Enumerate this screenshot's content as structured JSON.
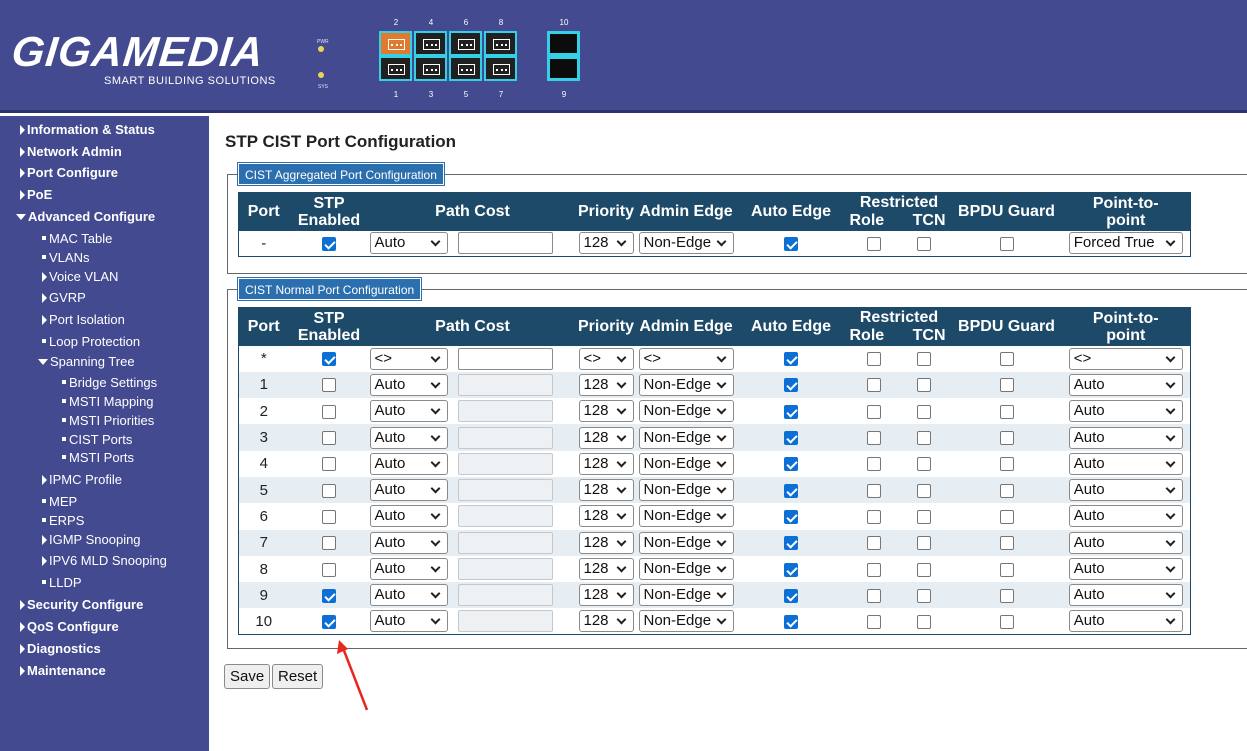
{
  "brand": {
    "logo": "GIGAMEDIA",
    "tagline": "SMART BUILDING SOLUTIONS",
    "led_labels": [
      "PWR",
      "SYS"
    ],
    "port_numbers_top": [
      "2",
      "4",
      "6",
      "8",
      "10"
    ],
    "port_numbers_bottom": [
      "1",
      "3",
      "5",
      "7",
      "9"
    ]
  },
  "sidebar": {
    "information_status": "Information & Status",
    "network_admin": "Network Admin",
    "port_configure": "Port Configure",
    "poe": "PoE",
    "advanced_configure": "Advanced Configure",
    "mac_table": "MAC Table",
    "vlans": "VLANs",
    "voice_vlan": "Voice VLAN",
    "gvrp": "GVRP",
    "port_isolation": "Port Isolation",
    "loop_protection": "Loop Protection",
    "spanning_tree": "Spanning Tree",
    "bridge_settings": "Bridge Settings",
    "msti_mapping": "MSTI Mapping",
    "msti_priorities": "MSTI Priorities",
    "cist_ports": "CIST Ports",
    "msti_ports": "MSTI Ports",
    "ipmc_profile": "IPMC Profile",
    "mep": "MEP",
    "erps": "ERPS",
    "igmp_snooping": "IGMP Snooping",
    "ipv6_mld_snooping": "IPV6 MLD Snooping",
    "lldp": "LLDP",
    "security_configure": "Security Configure",
    "qos_configure": "QoS Configure",
    "diagnostics": "Diagnostics",
    "maintenance": "Maintenance"
  },
  "page": {
    "title": "STP CIST Port Configuration"
  },
  "columns": {
    "port": "Port",
    "stp": "STP",
    "enabled": "Enabled",
    "path_cost": "Path Cost",
    "priority": "Priority",
    "admin_edge": "Admin Edge",
    "auto_edge": "Auto Edge",
    "restricted": "Restricted",
    "role": "Role",
    "tcn": "TCN",
    "bpdu_guard": "BPDU Guard",
    "p2p_top": "Point-to-",
    "p2p_bottom": "point"
  },
  "aggregated": {
    "legend": "CIST Aggregated Port Configuration",
    "rows": [
      {
        "port": "-",
        "stp": true,
        "path_cost": "Auto",
        "path_value": "",
        "path_enabled": true,
        "priority": "128",
        "admin_edge": "Non-Edge",
        "auto_edge": true,
        "restricted_role": false,
        "restricted_tcn": false,
        "bpdu_guard": false,
        "p2p": "Forced True"
      }
    ]
  },
  "normal": {
    "legend": "CIST Normal Port Configuration",
    "rows": [
      {
        "port": "*",
        "stp": true,
        "path_cost": "<>",
        "path_value": "",
        "path_enabled": true,
        "priority": "<>",
        "admin_edge": "<>",
        "auto_edge": true,
        "restricted_role": false,
        "restricted_tcn": false,
        "bpdu_guard": false,
        "p2p": "<>"
      },
      {
        "port": "1",
        "stp": false,
        "path_cost": "Auto",
        "path_value": "",
        "path_enabled": false,
        "priority": "128",
        "admin_edge": "Non-Edge",
        "auto_edge": true,
        "restricted_role": false,
        "restricted_tcn": false,
        "bpdu_guard": false,
        "p2p": "Auto"
      },
      {
        "port": "2",
        "stp": false,
        "path_cost": "Auto",
        "path_value": "",
        "path_enabled": false,
        "priority": "128",
        "admin_edge": "Non-Edge",
        "auto_edge": true,
        "restricted_role": false,
        "restricted_tcn": false,
        "bpdu_guard": false,
        "p2p": "Auto"
      },
      {
        "port": "3",
        "stp": false,
        "path_cost": "Auto",
        "path_value": "",
        "path_enabled": false,
        "priority": "128",
        "admin_edge": "Non-Edge",
        "auto_edge": true,
        "restricted_role": false,
        "restricted_tcn": false,
        "bpdu_guard": false,
        "p2p": "Auto"
      },
      {
        "port": "4",
        "stp": false,
        "path_cost": "Auto",
        "path_value": "",
        "path_enabled": false,
        "priority": "128",
        "admin_edge": "Non-Edge",
        "auto_edge": true,
        "restricted_role": false,
        "restricted_tcn": false,
        "bpdu_guard": false,
        "p2p": "Auto"
      },
      {
        "port": "5",
        "stp": false,
        "path_cost": "Auto",
        "path_value": "",
        "path_enabled": false,
        "priority": "128",
        "admin_edge": "Non-Edge",
        "auto_edge": true,
        "restricted_role": false,
        "restricted_tcn": false,
        "bpdu_guard": false,
        "p2p": "Auto"
      },
      {
        "port": "6",
        "stp": false,
        "path_cost": "Auto",
        "path_value": "",
        "path_enabled": false,
        "priority": "128",
        "admin_edge": "Non-Edge",
        "auto_edge": true,
        "restricted_role": false,
        "restricted_tcn": false,
        "bpdu_guard": false,
        "p2p": "Auto"
      },
      {
        "port": "7",
        "stp": false,
        "path_cost": "Auto",
        "path_value": "",
        "path_enabled": false,
        "priority": "128",
        "admin_edge": "Non-Edge",
        "auto_edge": true,
        "restricted_role": false,
        "restricted_tcn": false,
        "bpdu_guard": false,
        "p2p": "Auto"
      },
      {
        "port": "8",
        "stp": false,
        "path_cost": "Auto",
        "path_value": "",
        "path_enabled": false,
        "priority": "128",
        "admin_edge": "Non-Edge",
        "auto_edge": true,
        "restricted_role": false,
        "restricted_tcn": false,
        "bpdu_guard": false,
        "p2p": "Auto"
      },
      {
        "port": "9",
        "stp": true,
        "path_cost": "Auto",
        "path_value": "",
        "path_enabled": false,
        "priority": "128",
        "admin_edge": "Non-Edge",
        "auto_edge": true,
        "restricted_role": false,
        "restricted_tcn": false,
        "bpdu_guard": false,
        "p2p": "Auto"
      },
      {
        "port": "10",
        "stp": true,
        "path_cost": "Auto",
        "path_value": "",
        "path_enabled": false,
        "priority": "128",
        "admin_edge": "Non-Edge",
        "auto_edge": true,
        "restricted_role": false,
        "restricted_tcn": false,
        "bpdu_guard": false,
        "p2p": "Auto"
      }
    ]
  },
  "buttons": {
    "save": "Save",
    "reset": "Reset"
  },
  "colors": {
    "sidebar_bg": "#434a8f",
    "table_header": "#1e4a6a",
    "legend_bg": "#2c6fae",
    "checkbox_on": "#0b6fd6",
    "annotation_arrow": "#e8271f"
  }
}
